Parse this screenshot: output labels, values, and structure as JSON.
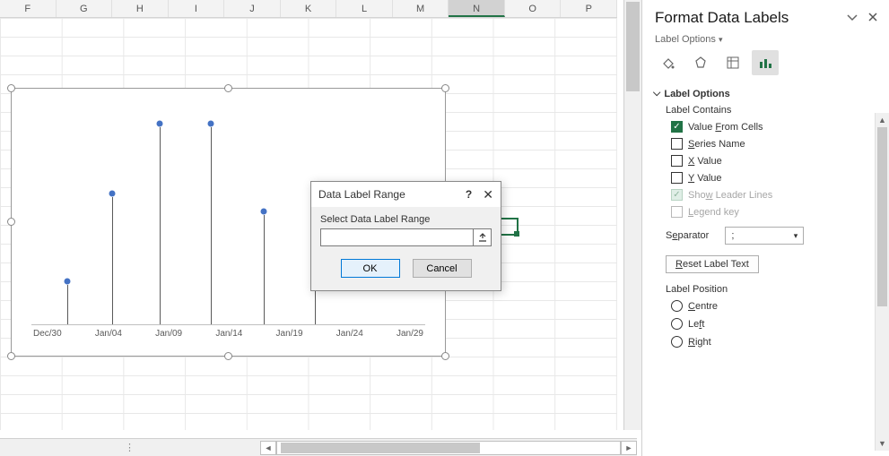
{
  "columns": [
    "F",
    "G",
    "H",
    "I",
    "J",
    "K",
    "L",
    "M",
    "N",
    "O",
    "P"
  ],
  "selected_column": "N",
  "chart_data": {
    "type": "stem",
    "categories": [
      "Dec/30",
      "Jan/04",
      "Jan/09",
      "Jan/14",
      "Jan/19",
      "Jan/24",
      "Jan/29"
    ],
    "values": [
      18,
      58,
      90,
      90,
      50,
      62,
      null
    ],
    "point_offsets_pct": [
      9,
      20.5,
      32.5,
      45.5,
      59,
      72,
      85.5
    ],
    "title": "",
    "xlabel": "",
    "ylabel": "",
    "ylim": [
      0,
      100
    ]
  },
  "dialog": {
    "title": "Data Label Range",
    "label": "Select Data Label Range",
    "value": "",
    "ok": "OK",
    "cancel": "Cancel"
  },
  "taskpane": {
    "title": "Format Data Labels",
    "subtitle": "Label Options",
    "section": "Label Options",
    "contains_header": "Label Contains",
    "opts": {
      "value_from_cells": "Value From Cells",
      "series_name": "Series Name",
      "x_value": "X Value",
      "y_value": "Y Value",
      "leader_lines": "Show Leader Lines",
      "legend_key": "Legend key"
    },
    "separator_label": "Separator",
    "separator_value": ";",
    "reset_label": "Reset Label Text",
    "position_header": "Label Position",
    "positions": {
      "centre": "Centre",
      "left": "Left",
      "right": "Right"
    }
  }
}
